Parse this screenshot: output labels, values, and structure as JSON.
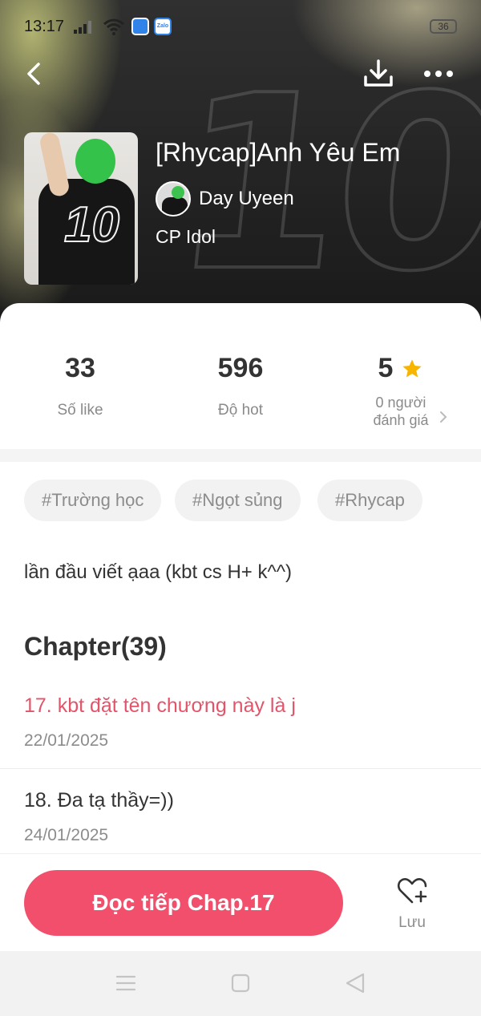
{
  "status_bar": {
    "time": "13:17",
    "battery": "36",
    "app_icon_2_text": "Zalo"
  },
  "toolbar": {
    "back_icon": "chevron-left-icon",
    "download_icon": "download-icon",
    "more_icon": "more-dots-icon"
  },
  "book": {
    "title": "[Rhycap]Anh Yêu Em",
    "author": "Day Uyeen",
    "category": "CP Idol",
    "cover_number": "10"
  },
  "stats": {
    "likes_value": "33",
    "likes_label": "Số like",
    "hot_value": "596",
    "hot_label": "Độ hot",
    "rating_value": "5",
    "rating_label_line1": "0 người",
    "rating_label_line2": "đánh giá",
    "rating_star_color": "#f7b500"
  },
  "tags": [
    "#Trường học",
    "#Ngọt sủng",
    "#Rhycap"
  ],
  "description": "lần đầu viết ạaa (kbt cs H+ k^^)",
  "chapters": {
    "heading": "Chapter(39)",
    "items": [
      {
        "title": "17. kbt đặt tên chương này là j",
        "date": "22/01/2025",
        "active": true
      },
      {
        "title": "18. Đa tạ thầy=))",
        "date": "24/01/2025",
        "active": false
      }
    ]
  },
  "actions": {
    "continue_label": "Đọc tiếp Chap.17",
    "save_label": "Lưu",
    "accent_color": "#f24f6c"
  },
  "system_nav": {
    "menu_icon": "menu-lines-icon",
    "home_icon": "square-home-icon",
    "back_icon": "triangle-back-icon"
  }
}
